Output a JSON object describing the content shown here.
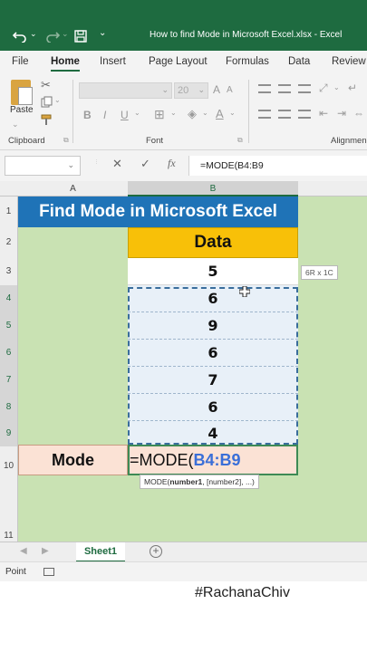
{
  "window": {
    "title": "How to find Mode in Microsoft Excel.xlsx  -  Excel"
  },
  "quick_access": {
    "undo_icon": "undo-icon",
    "redo_icon": "redo-icon",
    "save_icon": "save-icon",
    "customize_icon": "chevron-down-icon"
  },
  "ribbon": {
    "tabs": [
      "File",
      "Home",
      "Insert",
      "Page Layout",
      "Formulas",
      "Data",
      "Review"
    ],
    "active_tab": "Home",
    "groups": {
      "clipboard": "Clipboard",
      "font": "Font",
      "alignment": "Alignmen"
    },
    "paste_label": "Paste",
    "font_size": "20"
  },
  "formula_bar": {
    "name_box": "",
    "cancel": "✕",
    "enter": "✓",
    "fx": "fx",
    "content": "=MODE(B4:B9"
  },
  "sheet": {
    "columns": [
      "A",
      "B"
    ],
    "rows": [
      "1",
      "2",
      "3",
      "4",
      "5",
      "6",
      "7",
      "8",
      "9",
      "10",
      "11"
    ],
    "title": "Find Mode in Microsoft Excel",
    "data_header": "Data",
    "values": [
      "5",
      "6",
      "9",
      "6",
      "7",
      "6",
      "4"
    ],
    "mode_label": "Mode",
    "formula_prefix": "=MODE(",
    "formula_range": "B4:B9",
    "selection_size": "6R x 1C",
    "tooltip_func": "MODE(",
    "tooltip_arg1": "number1",
    "tooltip_rest": ", [number2], ...)"
  },
  "sheet_tabs": {
    "active": "Sheet1",
    "add_icon": "plus-circle-icon"
  },
  "status": {
    "mode": "Point"
  },
  "watermark": "#RachanaChiv",
  "colors": {
    "excel_green": "#1e6b40",
    "title_blue": "#1f73b7",
    "header_yellow": "#f8c008",
    "mode_peach": "#fbe2d5",
    "sheet_bg": "#c9e2b3",
    "range_blue": "#3a6fd8"
  }
}
